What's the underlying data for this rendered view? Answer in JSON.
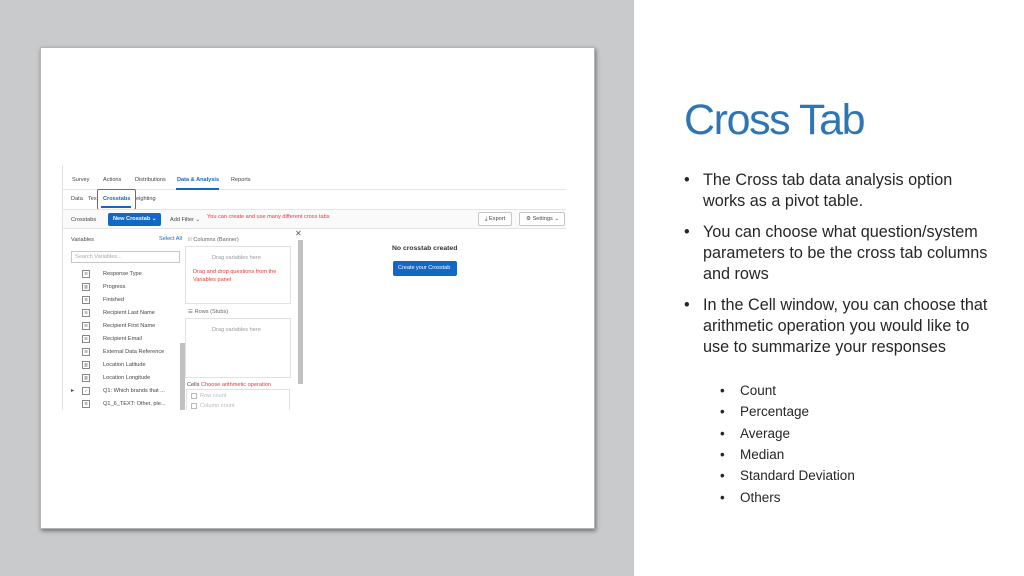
{
  "slide": {
    "title": "Cross Tab",
    "bullets": [
      "The Cross tab data analysis option works as a pivot table.",
      "You can choose what question/system parameters to be the cross tab columns and rows",
      "In the Cell window, you can choose that arithmetic operation you would like to use to summarize your responses"
    ],
    "sub_bullets": [
      "Count",
      "Percentage",
      "Average",
      "Median",
      "Standard Deviation",
      "Others"
    ]
  },
  "screenshot": {
    "top_nav": [
      "Survey",
      "Actions",
      "Distributions",
      "Data & Analysis",
      "Reports"
    ],
    "active_top": "Data & Analysis",
    "sub_nav": [
      "Data",
      "Text",
      "Crosstabs",
      "Weighting"
    ],
    "sub_nav_visible": [
      "Data",
      "Text",
      "Crosstabs",
      "eighting"
    ],
    "toolbar": {
      "label": "Crosstabs",
      "new_button": "New Crosstab",
      "add_filter": "Add Filter",
      "note": "You can create and use many different cross tabs",
      "export": "Export",
      "settings": "Settings"
    },
    "variables": {
      "header": "Variables",
      "select_all": "Select All",
      "search_placeholder": "Search Variables...",
      "items": [
        {
          "icon": "list-icon",
          "label": "Response Type"
        },
        {
          "icon": "chart-icon",
          "label": "Progress"
        },
        {
          "icon": "list-icon",
          "label": "Finished"
        },
        {
          "icon": "list-icon",
          "label": "Recipient Last Name"
        },
        {
          "icon": "list-icon",
          "label": "Recipient First Name"
        },
        {
          "icon": "list-icon",
          "label": "Recipient Email"
        },
        {
          "icon": "list-icon",
          "label": "External Data Reference"
        },
        {
          "icon": "chart-icon",
          "label": "Location Latitude"
        },
        {
          "icon": "chart-icon",
          "label": "Location Longitude"
        },
        {
          "icon": "check-icon",
          "label": "Q1: Which brands that ..."
        },
        {
          "icon": "list-icon",
          "label": "Q1_6_TEXT: Other, ple..."
        }
      ]
    },
    "columns_panel": {
      "header": "Columns (Banner)",
      "hint": "Drag variables here",
      "note": "Drag and drop questions from the Variables panel"
    },
    "rows_panel": {
      "header": "Rows (Stubs)",
      "hint": "Drag variables here"
    },
    "cells_panel": {
      "header": "Cells",
      "note": "Choose arithmetic operation",
      "options": [
        "Row count",
        "Column count"
      ]
    },
    "empty_state": {
      "title": "No crosstab created",
      "button": "Create your Crosstab"
    },
    "colors": {
      "accent": "#1268c4",
      "annotation": "#e23a3a",
      "title": "#2e75b6"
    }
  }
}
